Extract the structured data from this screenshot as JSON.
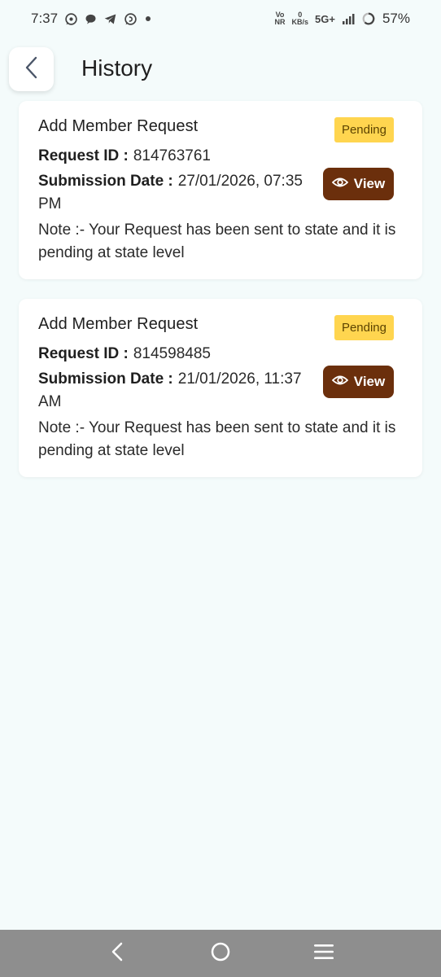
{
  "status_bar": {
    "time": "7:37",
    "volte_top": "Vo",
    "volte_bottom": "NR",
    "data_speed_value": "0",
    "data_speed_unit": "KB/s",
    "network": "5G+",
    "battery": "57%"
  },
  "header": {
    "title": "History"
  },
  "requests": [
    {
      "title": "Add Member Request",
      "status": "Pending",
      "request_id_label": "Request ID :",
      "request_id": "814763761",
      "submission_date_label": "Submission Date :",
      "submission_date": "27/01/2026, 07:35 PM",
      "view_label": "View",
      "note": "Note :- Your Request has been sent to state and it is pending at state level"
    },
    {
      "title": "Add Member Request",
      "status": "Pending",
      "request_id_label": "Request ID :",
      "request_id": "814598485",
      "submission_date_label": "Submission Date :",
      "submission_date": "21/01/2026, 11:37 AM",
      "view_label": "View",
      "note": "Note :- Your Request has been sent to state and it is pending at state level"
    }
  ],
  "colors": {
    "background": "#f4fbfb",
    "badge_pending": "#ffd54f",
    "view_button": "#6b2f0c",
    "nav_bar": "#8e8e8e"
  },
  "icons": {
    "back": "chevron-left-icon",
    "view": "eye-icon",
    "nav_back": "nav-back-icon",
    "nav_home": "nav-home-icon",
    "nav_recents": "nav-menu-icon"
  }
}
